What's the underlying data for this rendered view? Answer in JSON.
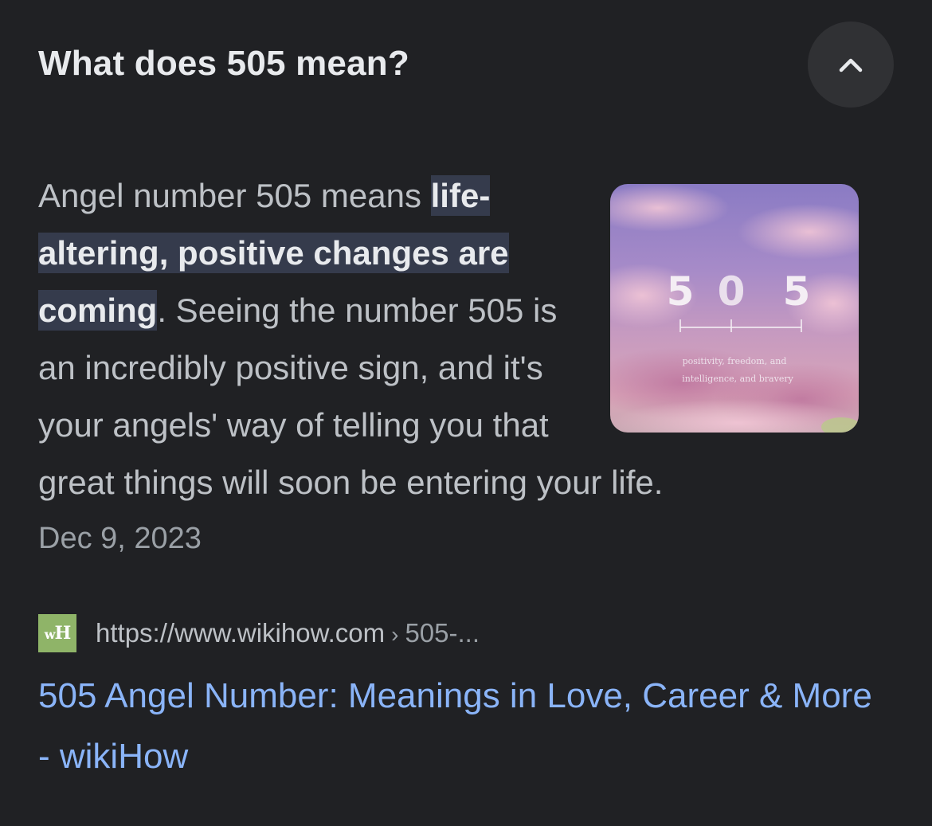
{
  "question": "What does 505 mean?",
  "collapse_icon": "chevron-up-icon",
  "snippet": {
    "intro": "Angel number 505 means ",
    "highlight_1": "life-",
    "highlight_2": "altering, positive changes are",
    "highlight_3": "coming",
    "rest": ". Seeing the number 505 is an incredibly positive sign, and it's your angels' way of telling you that great things will soon be entering your life."
  },
  "thumbnail": {
    "digits": [
      "5",
      "0",
      "5"
    ],
    "caption_1": "positivity, freedom, and",
    "caption_2": "intelligence, and bravery"
  },
  "date": "Dec 9, 2023",
  "source": {
    "favicon_icon": "wikihow-favicon-icon",
    "favicon_text_w": "w",
    "favicon_text_h": "H",
    "url": "https://www.wikihow.com",
    "separator": "›",
    "path": "505-..."
  },
  "result_title": "505 Angel Number: Meanings in Love, Career & More - wikiHow",
  "colors": {
    "background": "#202124",
    "text": "#e8eaed",
    "snippet_text": "#bdc1c6",
    "highlight_bg": "#353b4c",
    "link": "#8ab4f8",
    "muted": "#9aa0a6"
  }
}
